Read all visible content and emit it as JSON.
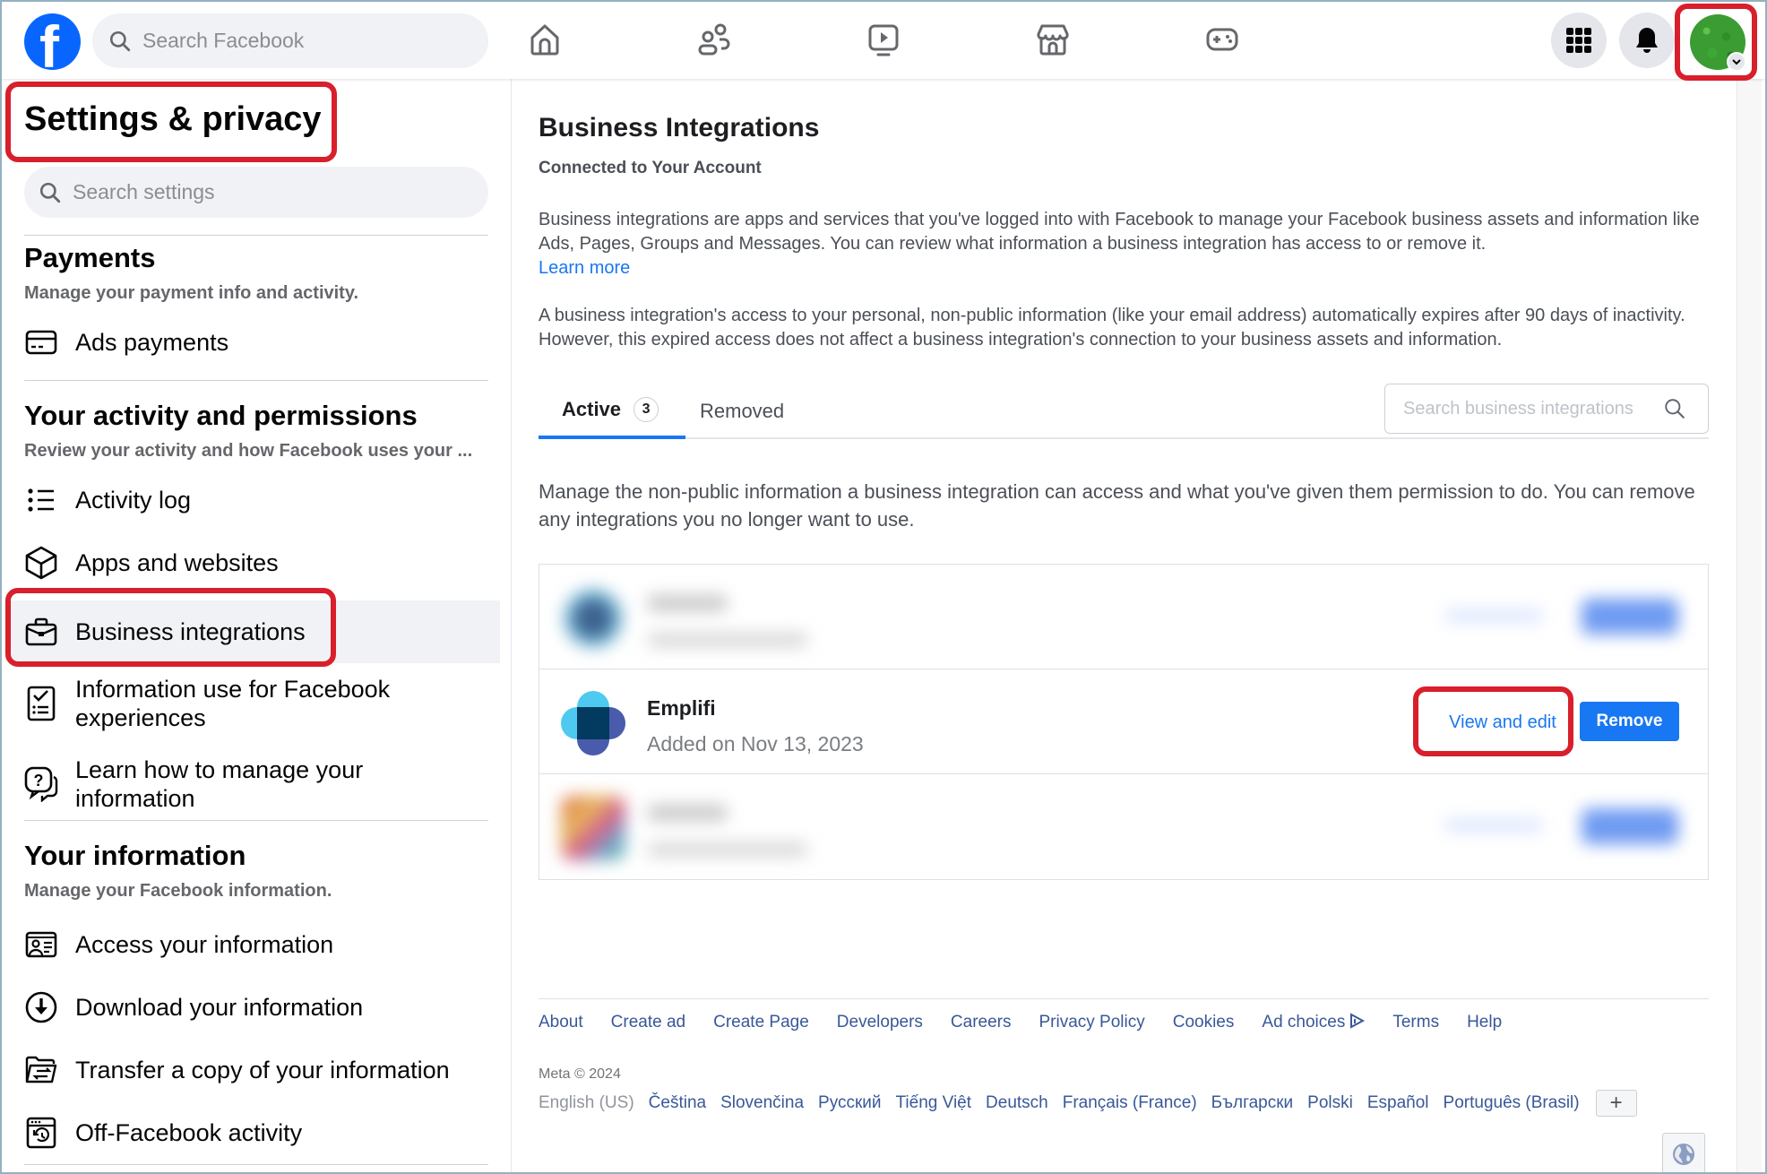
{
  "topnav": {
    "logo": "facebook-logo",
    "search_placeholder": "Search Facebook",
    "nav_icons": [
      "home-icon",
      "friends-icon",
      "watch-icon",
      "marketplace-icon",
      "gaming-icon"
    ],
    "right_buttons": [
      "menu-grid-icon",
      "notifications-bell-icon",
      "account-avatar"
    ]
  },
  "sidebar": {
    "title": "Settings & privacy",
    "search_placeholder": "Search settings",
    "sections": [
      {
        "title": "Payments",
        "subtitle": "Manage your payment info and activity.",
        "items": [
          {
            "label": "Ads payments",
            "icon": "credit-card-icon"
          }
        ]
      },
      {
        "title": "Your activity and permissions",
        "subtitle": "Review your activity and how Facebook uses your ...",
        "items": [
          {
            "label": "Activity log",
            "icon": "list-icon"
          },
          {
            "label": "Apps and websites",
            "icon": "cube-icon"
          },
          {
            "label": "Business integrations",
            "icon": "briefcase-icon",
            "active": true
          },
          {
            "label": "Information use for Facebook experiences",
            "icon": "checklist-icon"
          },
          {
            "label": "Learn how to manage your information",
            "icon": "question-bubble-icon"
          }
        ]
      },
      {
        "title": "Your information",
        "subtitle": "Manage your Facebook information.",
        "items": [
          {
            "label": "Access your information",
            "icon": "id-card-icon"
          },
          {
            "label": "Download your information",
            "icon": "download-circle-icon"
          },
          {
            "label": "Transfer a copy of your information",
            "icon": "folder-transfer-icon"
          },
          {
            "label": "Off-Facebook activity",
            "icon": "history-window-icon"
          }
        ]
      }
    ]
  },
  "main": {
    "title": "Business Integrations",
    "subtitle": "Connected to Your Account",
    "intro": "Business integrations are apps and services that you've logged into with Facebook to manage your Facebook business assets and information like Ads, Pages, Groups and Messages. You can review what information a business integration has access to or remove it.",
    "learn_more": "Learn more",
    "expiry_note": "A business integration's access to your personal, non-public information (like your email address) automatically expires after 90 days of inactivity. However, this expired access does not affect a business integration's connection to your business assets and information.",
    "tabs": [
      {
        "label": "Active",
        "count": "3",
        "active": true
      },
      {
        "label": "Removed",
        "active": false
      }
    ],
    "search_placeholder": "Search business integrations",
    "manage_text": "Manage the non-public information a business integration can access and what you've given them permission to do. You can remove any integrations you no longer want to use.",
    "integrations": [
      {
        "name": "",
        "date": "",
        "blurred": true,
        "view_label": "",
        "remove_label": ""
      },
      {
        "name": "Emplifi",
        "date": "Added on Nov 13, 2023",
        "blurred": false,
        "view_label": "View and edit",
        "remove_label": "Remove"
      },
      {
        "name": "",
        "date": "",
        "blurred": true,
        "view_label": "",
        "remove_label": ""
      }
    ]
  },
  "footer": {
    "links": [
      "About",
      "Create ad",
      "Create Page",
      "Developers",
      "Careers",
      "Privacy Policy",
      "Cookies",
      "Ad choices",
      "Terms",
      "Help"
    ],
    "copyright": "Meta © 2024",
    "current_language": "English (US)",
    "languages": [
      "Čeština",
      "Slovenčina",
      "Русский",
      "Tiếng Việt",
      "Deutsch",
      "Français (France)",
      "Български",
      "Polski",
      "Español",
      "Português (Brasil)"
    ],
    "add_language": "+"
  },
  "colors": {
    "brand": "#0866ff",
    "accent": "#1877f2",
    "highlight": "#d81f2b",
    "link": "#385898"
  }
}
